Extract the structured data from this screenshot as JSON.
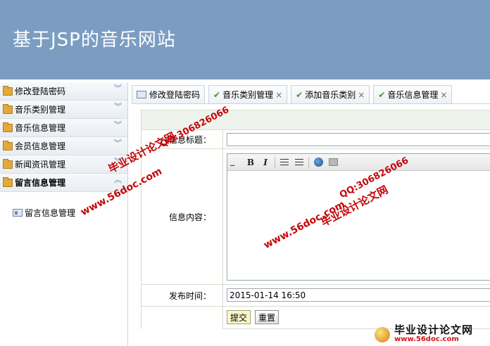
{
  "header": {
    "title": "基于JSP的音乐网站",
    "bg_color": "#7b9dc2"
  },
  "sidebar": {
    "items": [
      {
        "label": "修改登陆密码",
        "icon": "folder-icon",
        "state": "collapsed"
      },
      {
        "label": "音乐类别管理",
        "icon": "folder-icon",
        "state": "collapsed"
      },
      {
        "label": "音乐信息管理",
        "icon": "folder-icon",
        "state": "collapsed"
      },
      {
        "label": "会员信息管理",
        "icon": "folder-icon",
        "state": "collapsed"
      },
      {
        "label": "新闻资讯管理",
        "icon": "folder-icon",
        "state": "collapsed"
      },
      {
        "label": "留言信息管理",
        "icon": "folder-icon",
        "state": "expanded"
      }
    ],
    "sub_items": [
      {
        "label": "留言信息管理",
        "icon": "user-card-icon"
      }
    ]
  },
  "tabs": [
    {
      "label": "修改登陆密码",
      "icon": "user-card-icon",
      "closable": false
    },
    {
      "label": "音乐类别管理",
      "icon": "check-icon",
      "closable": true
    },
    {
      "label": "添加音乐类别",
      "icon": "check-icon",
      "closable": true
    },
    {
      "label": "音乐信息管理",
      "icon": "check-icon",
      "closable": true
    }
  ],
  "form": {
    "title_label": "信息标题：",
    "title_value": "",
    "content_label": "信息内容：",
    "time_label": "发布时间：",
    "time_value": "2015-01-14 16:50",
    "submit_label": "提交",
    "reset_label": "重置"
  },
  "editor_toolbar": {
    "bold": "B",
    "italic": "I",
    "icons": [
      "bold-icon",
      "italic-icon",
      "ordered-list-icon",
      "unordered-list-icon",
      "link-globe-icon",
      "image-icon"
    ]
  },
  "watermarks": {
    "site_cn": "毕业设计论文网",
    "url": "www.56doc.com",
    "qq": "QQ:306826066",
    "footer_cn": "毕业设计论文网",
    "footer_url": "www.56doc.com",
    "color": "#c4070a"
  }
}
